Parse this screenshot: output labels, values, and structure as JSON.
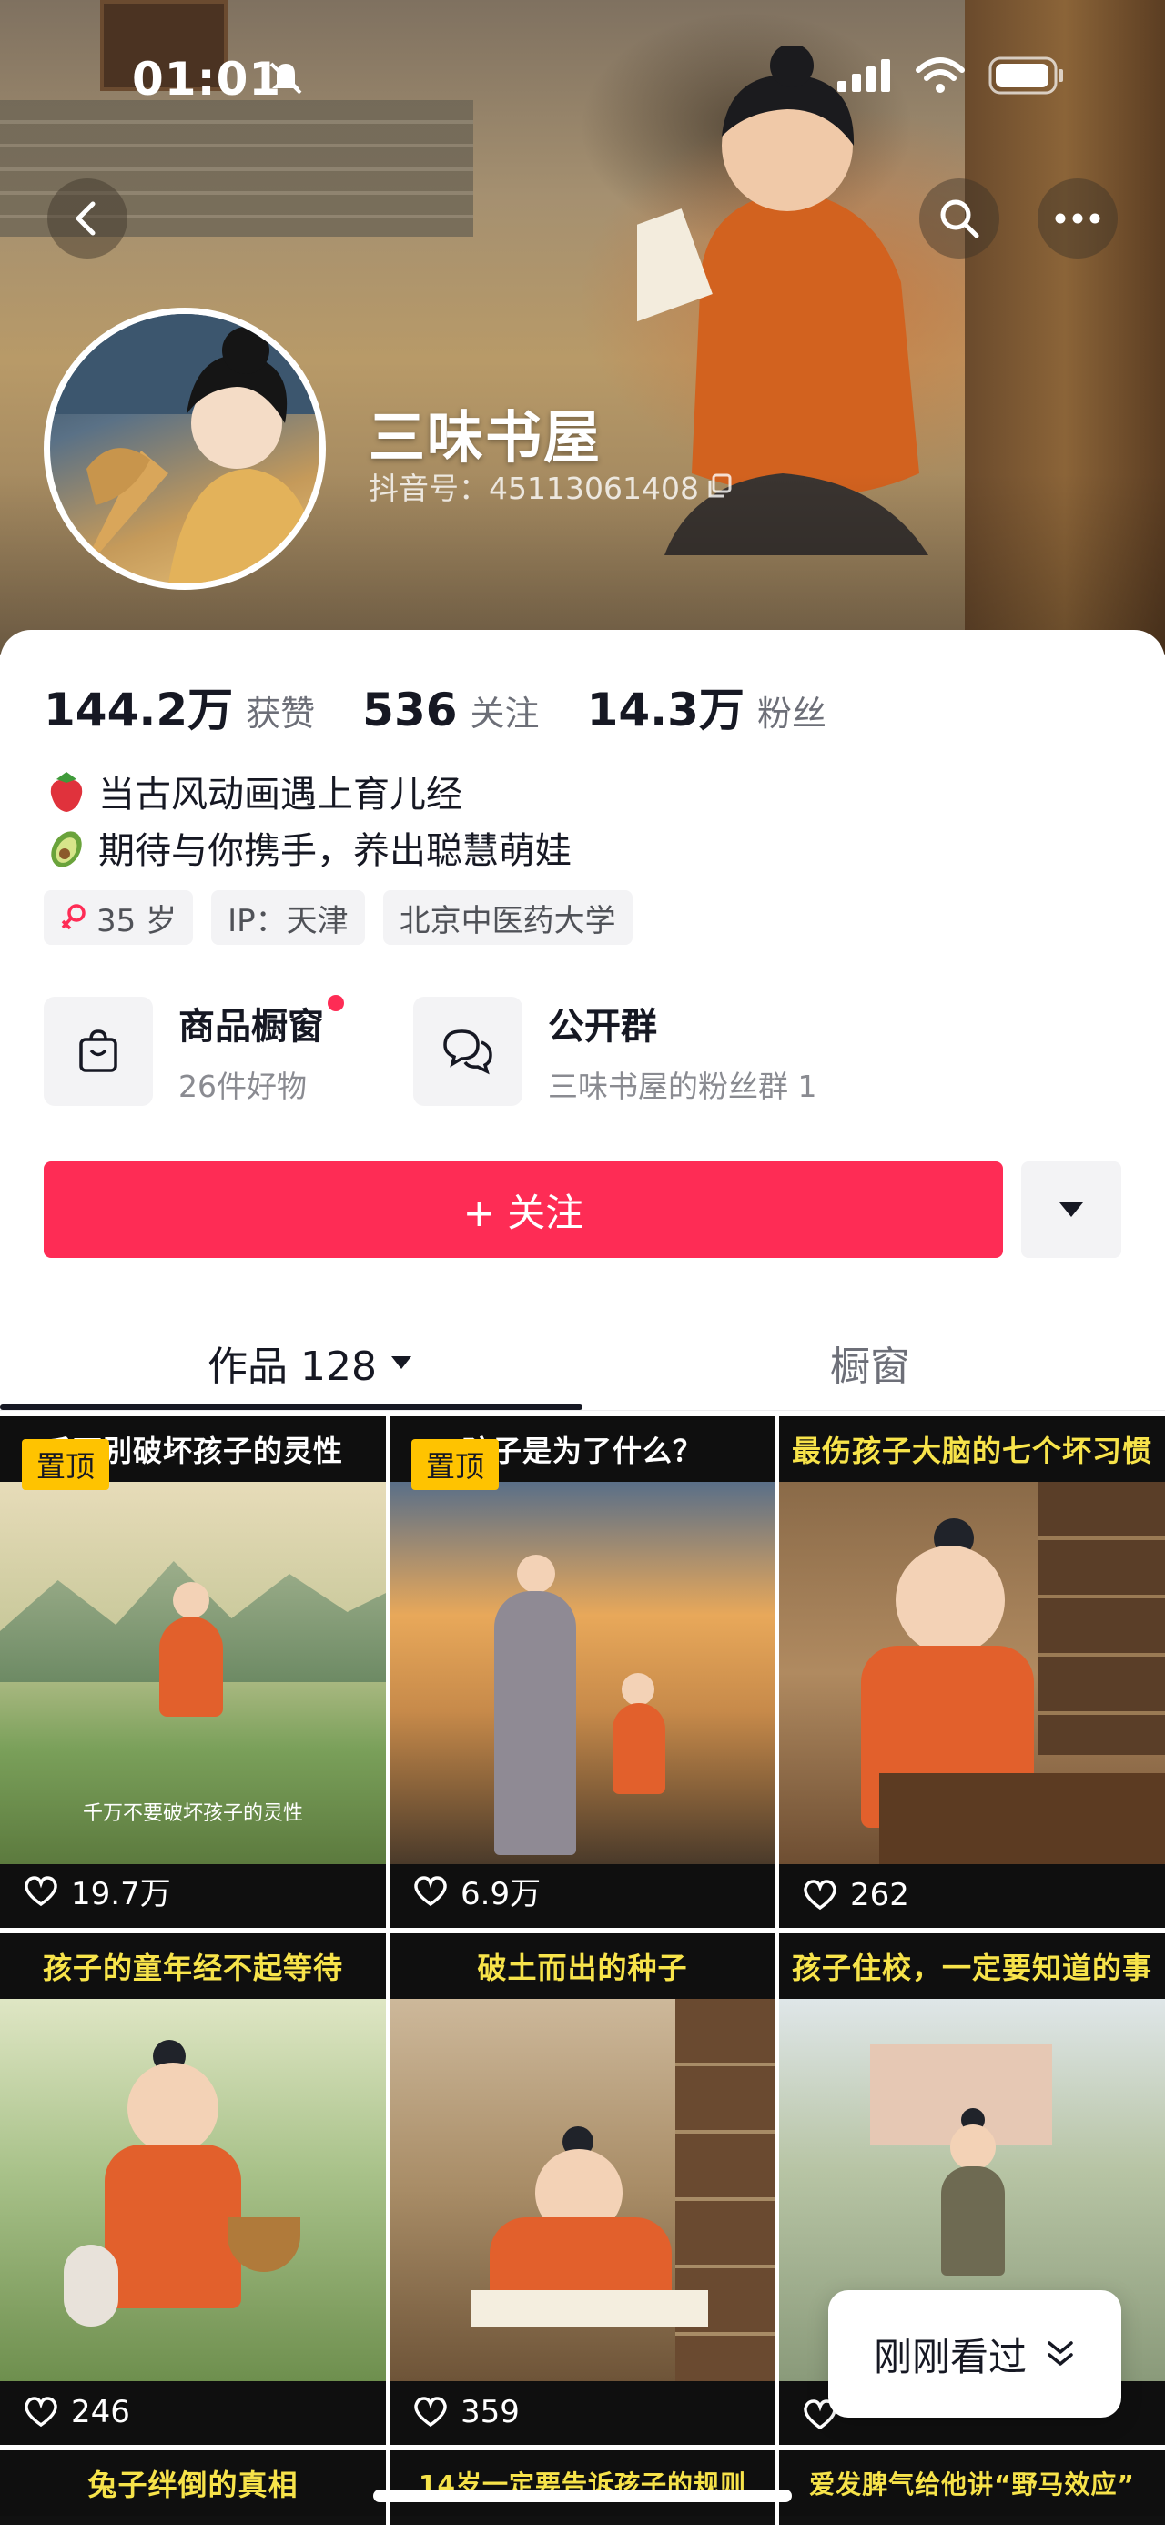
{
  "status_bar": {
    "time": "01:01"
  },
  "profile": {
    "name": "三味书屋",
    "douyin_id": "抖音号：45113061408",
    "stats": [
      {
        "num": "144.2万",
        "label": "获赞"
      },
      {
        "num": "536",
        "label": "关注"
      },
      {
        "num": "14.3万",
        "label": "粉丝"
      }
    ],
    "bio": [
      "当古风动画遇上育儿经",
      "期待与你携手，养出聪慧萌娃"
    ],
    "tags": {
      "age": "35 岁",
      "ip": "IP：天津",
      "school": "北京中医药大学"
    }
  },
  "features": {
    "shop": {
      "title": "商品橱窗",
      "sub": "26件好物"
    },
    "group": {
      "title": "公开群",
      "sub": "三味书屋的粉丝群 1"
    }
  },
  "actions": {
    "follow": "+ 关注"
  },
  "tabs": {
    "works": "作品 128",
    "window": "橱窗"
  },
  "videos": [
    {
      "caption": "千万别破坏孩子的灵性",
      "likes": "19.7万",
      "pinned": "置顶",
      "subtitle": "千万不要破坏孩子的灵性"
    },
    {
      "caption": "孩子是为了什么？",
      "likes": "6.9万",
      "pinned": "置顶"
    },
    {
      "caption": "最伤孩子大脑的七个坏习惯",
      "likes": "262"
    },
    {
      "caption": "孩子的童年经不起等待",
      "likes": "246"
    },
    {
      "caption": "破土而出的种子",
      "likes": "359"
    },
    {
      "caption": "孩子住校，一定要知道的事",
      "likes": ""
    },
    {
      "caption": "兔子绊倒的真相"
    },
    {
      "caption": "14岁一定要告诉孩子的规则"
    },
    {
      "caption": "爱发脾气给他讲“野马效应”"
    }
  ],
  "recent_button": "刚刚看过"
}
